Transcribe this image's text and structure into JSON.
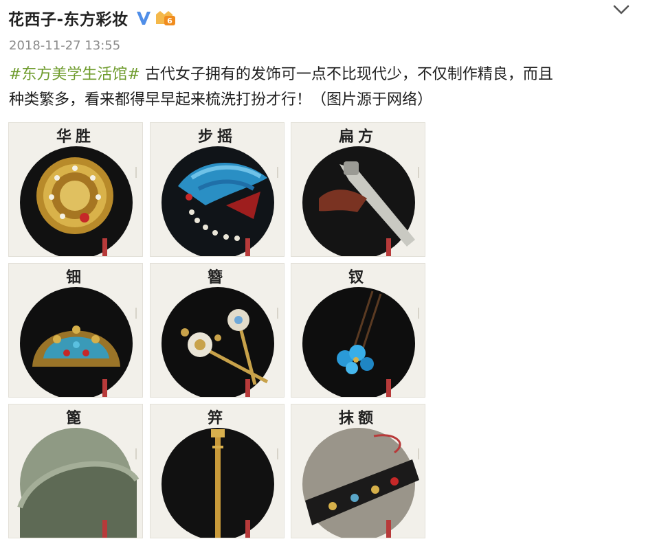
{
  "post": {
    "username": "花西子-东方彩妆",
    "verified_icon": "verified-v-icon",
    "level_icon": "level-badge-icon",
    "timestamp": "2018-11-27 13:55",
    "hashtag": "#东方美学生活馆#",
    "body_line1": " 古代女子拥有的发饰可一点不比现代少，不仅制作精良，而且",
    "body_line2": "种类繁多，看来都得早早起来梳洗打扮才行！（图片源于网络）"
  },
  "colors": {
    "hashtag": "#6e9b2c",
    "verified": "#4f8ee8",
    "badge": "#f29b2a"
  },
  "gallery": {
    "tiles": [
      {
        "label": "华胜"
      },
      {
        "label": "步摇"
      },
      {
        "label": "扁方"
      },
      {
        "label": "钿"
      },
      {
        "label": "簪"
      },
      {
        "label": "钗"
      },
      {
        "label": "篦"
      },
      {
        "label": "笄"
      },
      {
        "label": "抹额"
      }
    ]
  }
}
